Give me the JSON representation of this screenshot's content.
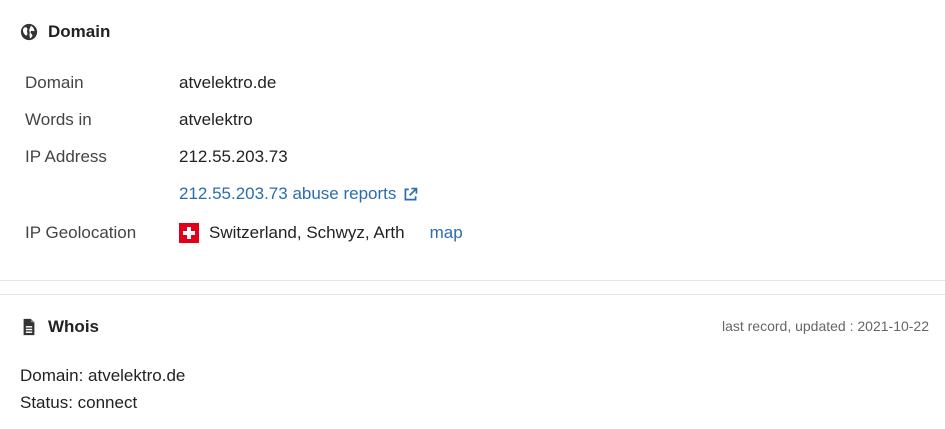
{
  "domain_section": {
    "title": "Domain",
    "icon": "globe-icon",
    "rows": [
      {
        "label": "Domain",
        "value": "atvelektro.de"
      },
      {
        "label": "Words in",
        "value": "atvelektro"
      },
      {
        "label": "IP Address",
        "value": "212.55.203.73"
      },
      {
        "label": "",
        "value": "212.55.203.73 abuse reports"
      },
      {
        "label": "IP Geolocation",
        "value": "Switzerland, Schwyz, Arth",
        "link": "map"
      }
    ]
  },
  "whois_section": {
    "title": "Whois",
    "icon": "document-icon",
    "updated": "last record, updated : 2021-10-22",
    "lines": [
      "Domain: atvelektro.de",
      "Status: connect"
    ]
  },
  "colors": {
    "link": "#2b6cb0",
    "flag_red": "#e0001b",
    "icon": "#333333"
  }
}
